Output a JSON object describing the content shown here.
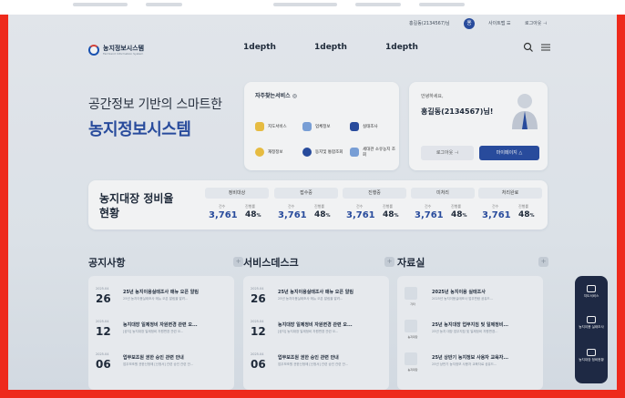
{
  "top_strip": {},
  "utility": {
    "user": "홍길동(2134567)님",
    "avatar_letter": "홍",
    "link1": "사이트맵 ☰",
    "link2": "로그아웃 ⊣"
  },
  "header": {
    "logo_title": "농지정보시스템",
    "logo_sub": "Farmland Information System",
    "nav": [
      "1depth",
      "1depth",
      "1depth"
    ],
    "icons": [
      "search-icon",
      "hamburger-menu-icon"
    ]
  },
  "hero": {
    "line1": "공간정보 기반의 스마트한",
    "line2": "농지정보시스템"
  },
  "quick": {
    "title": "자주찾는서비스 ◎",
    "items": [
      {
        "label": "지도서비스",
        "icon": "map-icon"
      },
      {
        "label": "업체정보",
        "icon": "building-icon"
      },
      {
        "label": "실태조사",
        "icon": "survey-icon"
      },
      {
        "label": "재정정보",
        "icon": "finance-icon"
      },
      {
        "label": "동지및 통합조회",
        "icon": "search-globe-icon"
      },
      {
        "label": "세대관 소유농지 조회",
        "icon": "document-icon"
      }
    ]
  },
  "login": {
    "greeting": "안녕하세요,",
    "name": "홍길동(2134567)님!",
    "logout": "로그아웃 ⊣",
    "mypage": "마이페이지 △"
  },
  "status": {
    "title_l1": "농지대장 정비율",
    "title_l2": "현황",
    "label_count": "건수",
    "label_rate": "진행률",
    "cols": [
      {
        "label": "정비대상",
        "icon": "wrench-icon",
        "count": "3,761",
        "rate": "48",
        "unit": "%"
      },
      {
        "label": "접수중",
        "icon": "inbox-icon",
        "count": "3,761",
        "rate": "48",
        "unit": "%"
      },
      {
        "label": "진행중",
        "icon": "progress-icon",
        "count": "3,761",
        "rate": "48",
        "unit": "%"
      },
      {
        "label": "미처리",
        "icon": "pending-icon",
        "count": "3,761",
        "rate": "48",
        "unit": "%"
      },
      {
        "label": "처리완료",
        "icon": "check-icon",
        "count": "3,761",
        "rate": "48",
        "unit": "%"
      }
    ]
  },
  "sections": {
    "notice": {
      "title": "공지사항",
      "rows": [
        {
          "ym": "2025.04",
          "day": "26",
          "title": "25년 농지이용실태조사 매뉴 오픈 알림",
          "sub": "25년 농지이용실태조사 매뉴 오픈 알림을 알려..."
        },
        {
          "ym": "2025.04",
          "day": "12",
          "title": "농지대장 일제정비 자원변경 관련 오...",
          "sub": "[공지] 농지대장 일제정비 자원변경 관련 오..."
        },
        {
          "ym": "2025.04",
          "day": "06",
          "title": "업무보조원 권한 승인 관련 안내",
          "sub": "업무보조원 권한신청에 [신청서] 관련 승인 관련 안..."
        }
      ]
    },
    "service": {
      "title": "서비스데스크",
      "rows": [
        {
          "ym": "2025.04",
          "day": "26",
          "title": "25년 농지이용실태조사 매뉴 오픈 알림",
          "sub": "25년 농지이용실태조사 매뉴 오픈 알림을 알려..."
        },
        {
          "ym": "2025.04",
          "day": "12",
          "title": "농지대장 일제정비 자원변경 관련 오...",
          "sub": "[공지] 농지대장 일제정비 자원변경 관련 오..."
        },
        {
          "ym": "2025.04",
          "day": "06",
          "title": "업무보조원 권한 승인 관련 안내",
          "sub": "업무보조원 권한신청에 [신청서] 관련 승인 관련 안..."
        }
      ]
    },
    "data": {
      "title": "자료실",
      "rows": [
        {
          "type": "기타",
          "title": "2025년 농지이용 실태조사",
          "sub": "2025년 농지이용실태조사 업무편람 공유드..."
        },
        {
          "type": "농지대장",
          "title": "25년 농지대장 업무지침 및 일제정비...",
          "sub": "25년 농지 대장 업무지침 및 일제정비 자원변경..."
        },
        {
          "type": "농지대장",
          "title": "25년 상반기 농지정보 사용자 교육자...",
          "sub": "25년 상반기 농지정보 사용자 교육자료 공유드..."
        }
      ]
    }
  },
  "quickbar": [
    "지도서비스",
    "농지이용 실태조사",
    "농지대장 정비현황"
  ]
}
